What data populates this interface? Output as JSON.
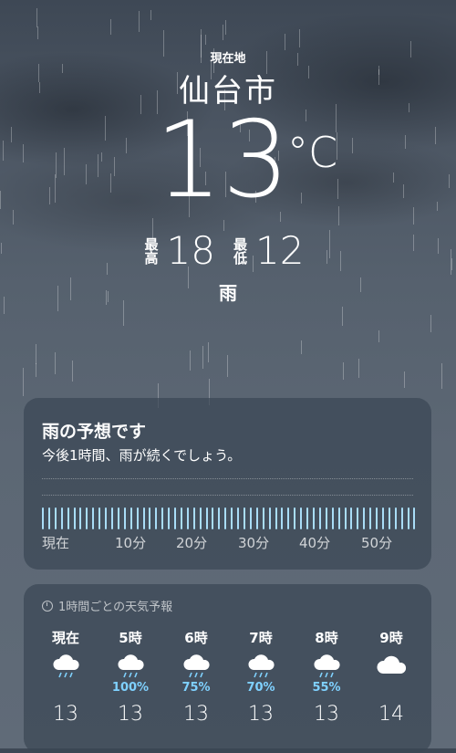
{
  "location": {
    "label": "現在地",
    "city": "仙台市",
    "temperature": "13",
    "unit": "°C",
    "high_label": "最高",
    "high": "18",
    "low_label": "最低",
    "low": "12",
    "condition": "雨"
  },
  "rain_forecast": {
    "title": "雨の予想です",
    "subtitle": "今後1時間、雨が続くでしょう。",
    "ticks": [
      "現在",
      "10分",
      "20分",
      "30分",
      "40分",
      "50分"
    ],
    "bar_color": "#a9ddf7",
    "intensity_level": 1.0
  },
  "hourly": {
    "header": "1時間ごとの天気予報",
    "items": [
      {
        "time": "現在",
        "icon": "rain-icon",
        "pop": "",
        "temp": "13"
      },
      {
        "time": "5時",
        "icon": "rain-icon",
        "pop": "100%",
        "temp": "13"
      },
      {
        "time": "6時",
        "icon": "rain-icon",
        "pop": "75%",
        "temp": "13"
      },
      {
        "time": "7時",
        "icon": "rain-icon",
        "pop": "70%",
        "temp": "13"
      },
      {
        "time": "8時",
        "icon": "rain-icon",
        "pop": "55%",
        "temp": "13"
      },
      {
        "time": "9時",
        "icon": "cloud-icon",
        "pop": "",
        "temp": "14"
      }
    ]
  },
  "colors": {
    "accent": "#7fd1ff",
    "card_bg": "#3a4654"
  }
}
